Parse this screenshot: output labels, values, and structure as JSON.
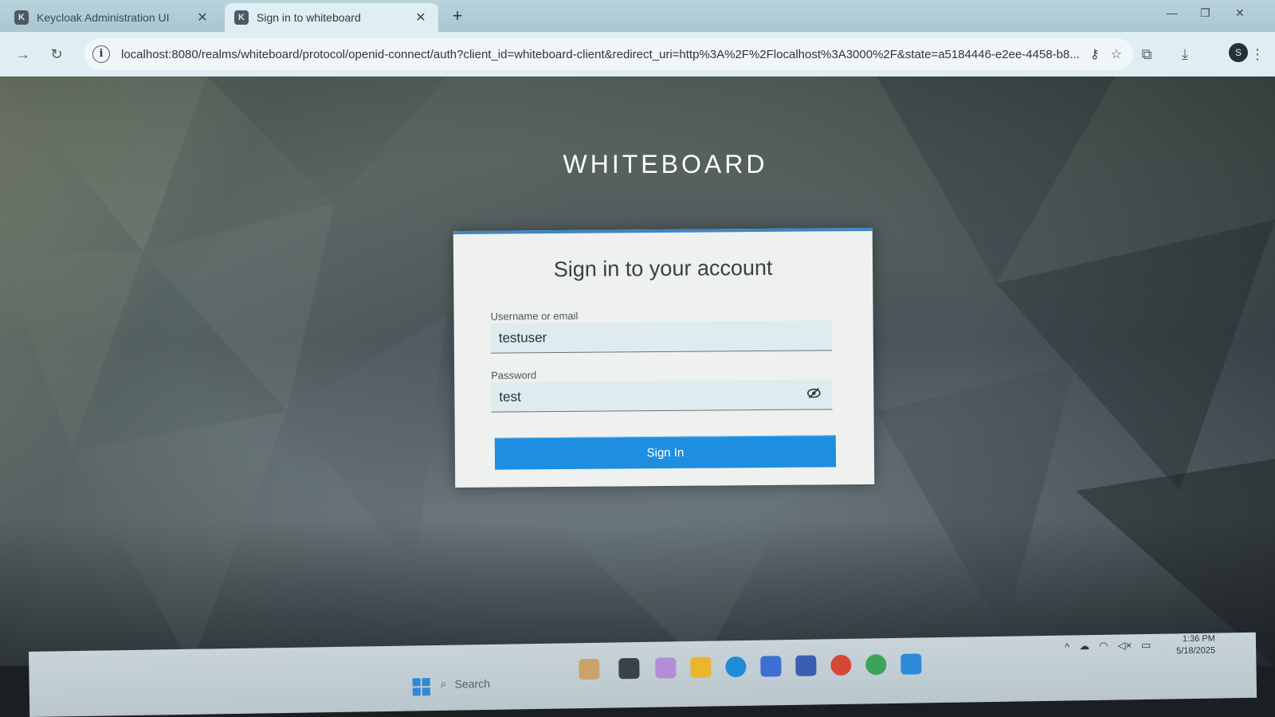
{
  "browser": {
    "tabs": [
      {
        "title": "Keycloak Administration UI",
        "close": "✕"
      },
      {
        "title": "Sign in to whiteboard",
        "close": "✕"
      }
    ],
    "new_tab": "+",
    "url": "localhost:8080/realms/whiteboard/protocol/openid-connect/auth?client_id=whiteboard-client&redirect_uri=http%3A%2F%2Flocalhost%3A3000%2F&state=a5184446-e2ee-4458-b8...",
    "profile_initial": "S"
  },
  "login": {
    "brand": "WHITEBOARD",
    "title": "Sign in to your account",
    "username_label": "Username or email",
    "username_value": "testuser",
    "password_label": "Password",
    "password_value": "test",
    "submit_label": "Sign In"
  },
  "taskbar": {
    "search_placeholder": "Search",
    "time": "1:36 PM",
    "date": "5/18/2025"
  },
  "colors": {
    "accent": "#1e8fe0",
    "card_top_border": "#3f86c4"
  }
}
